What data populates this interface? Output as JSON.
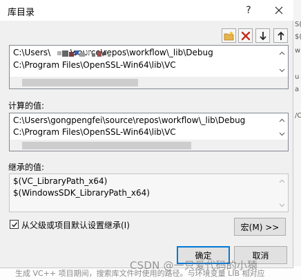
{
  "dialog": {
    "title": "库目录",
    "help_label": "?",
    "close_label": "close"
  },
  "toolbar": {
    "new_line_icon": "folder-new-icon",
    "delete_icon": "delete-x-icon",
    "move_down_icon": "arrow-down-icon",
    "move_up_icon": "arrow-up-icon",
    "delete_color": "#c42b1c"
  },
  "edit_list": {
    "lines": [
      "C:\\Users\\            \\source\\repos\\workflow\\_lib\\Debug",
      "C:\\Program Files\\OpenSSL-Win64\\lib\\VC"
    ]
  },
  "evaluated": {
    "label": "计算的值:",
    "lines": [
      "C:\\Users\\gongpengfei\\source\\repos\\workflow\\_lib\\Debug",
      "C:\\Program Files\\OpenSSL-Win64\\lib\\VC"
    ]
  },
  "inherited": {
    "label": "继承的值:",
    "lines": [
      "$(VC_LibraryPath_x64)",
      "$(WindowsSDK_LibraryPath_x64)"
    ]
  },
  "inherit_checkbox": {
    "label": "从父级或项目默认设置继承(I)",
    "checked": true
  },
  "buttons": {
    "macros": "宏(M) >>",
    "ok": "确定",
    "cancel": "取消"
  },
  "background": {
    "bottom_text": "生成 VC++ 项目期间，搜索库文件时使用的路径。与环境变量 LIB 相对应",
    "watermark": "CSDN @一只爱代码的小猿"
  },
  "colors": {
    "accent": "#0078d7",
    "dialog_bg": "#f0f0f0"
  }
}
